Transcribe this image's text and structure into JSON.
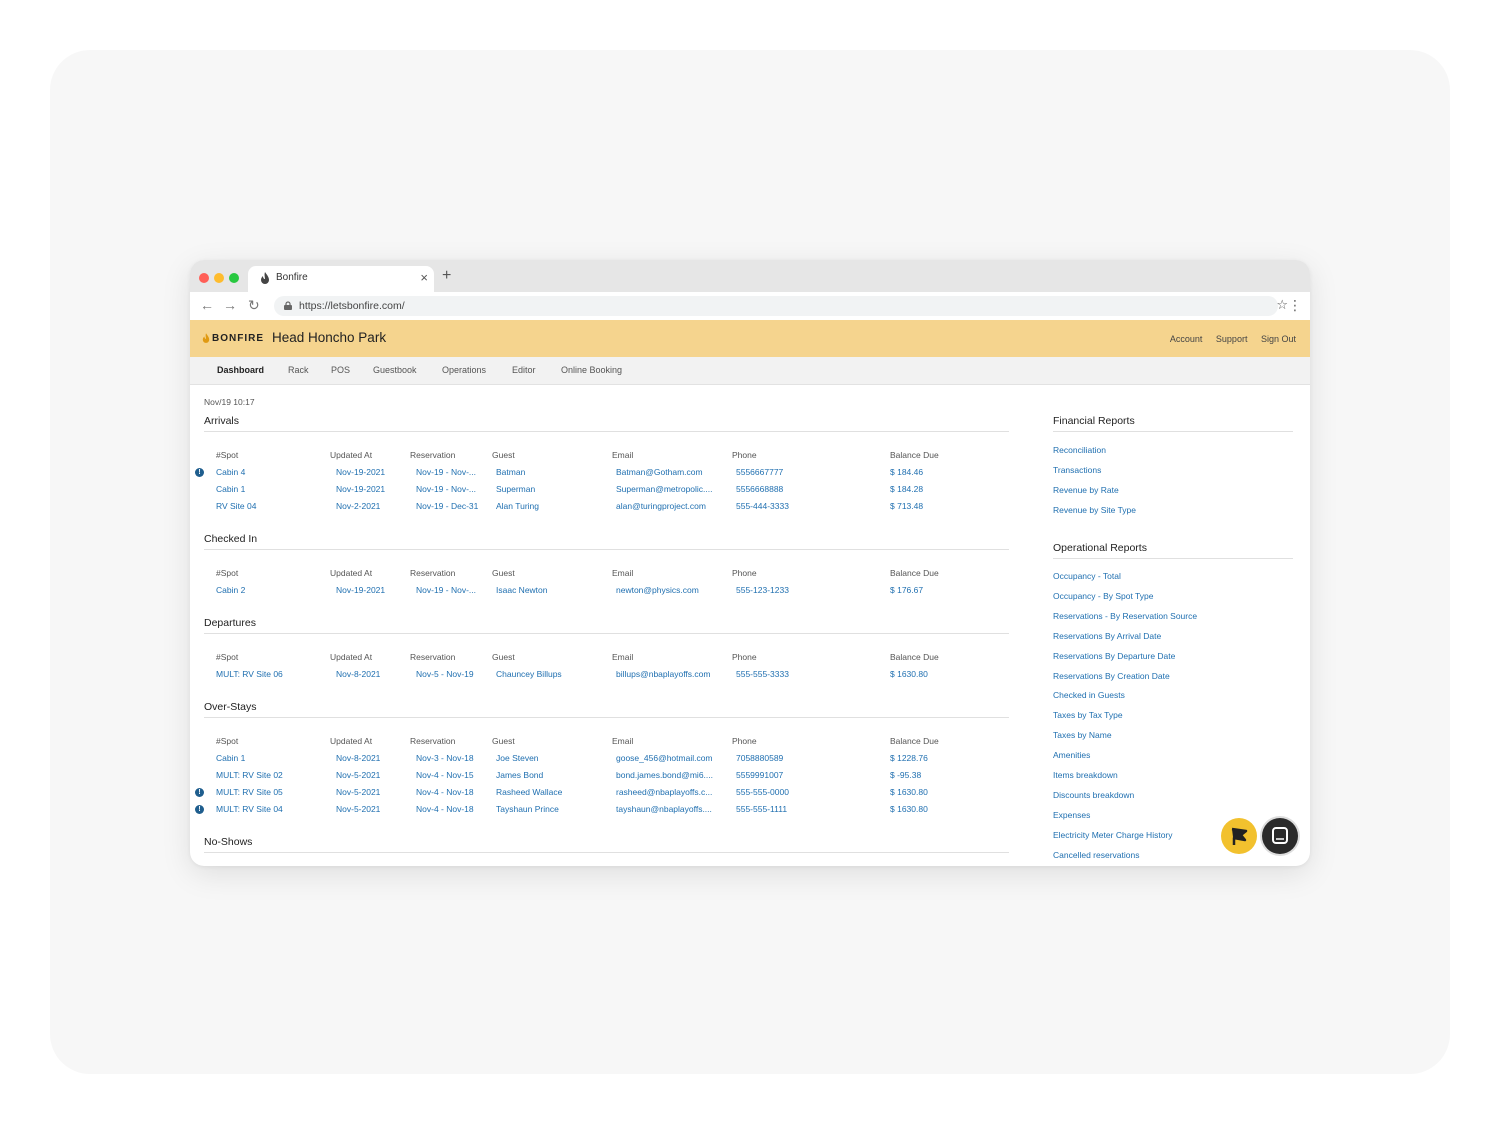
{
  "browser": {
    "tab_title": "Bonfire",
    "url": "https://letsbonfire.com/"
  },
  "app": {
    "brand": "BONFIRE",
    "park_name": "Head Honcho Park",
    "top_links": [
      "Account",
      "Support",
      "Sign Out"
    ],
    "nav_tabs": [
      "Dashboard",
      "Rack",
      "POS",
      "Guestbook",
      "Operations",
      "Editor",
      "Online Booking"
    ],
    "active_tab": "Dashboard",
    "colors": {
      "header": "#f5d48e",
      "link": "#1f6fb0",
      "fab": "#f2c12e"
    }
  },
  "dashboard": {
    "timestamp": "Nov/19 10:17",
    "columns": [
      "#Spot",
      "Updated At",
      "Reservation",
      "Guest",
      "Email",
      "Phone",
      "Balance Due"
    ],
    "sections": [
      {
        "title": "Arrivals",
        "rows": [
          {
            "alert": true,
            "cells": [
              "Cabin 4",
              "Nov-19-2021",
              "Nov-19 - Nov-...",
              "Batman",
              "Batman@Gotham.com",
              "5556667777",
              "$ 184.46"
            ]
          },
          {
            "alert": false,
            "cells": [
              "Cabin 1",
              "Nov-19-2021",
              "Nov-19 - Nov-...",
              "Superman",
              "Superman@metropolic....",
              "5556668888",
              "$ 184.28"
            ]
          },
          {
            "alert": false,
            "cells": [
              "RV Site 04",
              "Nov-2-2021",
              "Nov-19 - Dec-31",
              "Alan Turing",
              "alan@turingproject.com",
              "555-444-3333",
              "$ 713.48"
            ]
          }
        ]
      },
      {
        "title": "Checked In",
        "rows": [
          {
            "alert": false,
            "cells": [
              "Cabin 2",
              "Nov-19-2021",
              "Nov-19 - Nov-...",
              "Isaac Newton",
              "newton@physics.com",
              "555-123-1233",
              "$ 176.67"
            ]
          }
        ]
      },
      {
        "title": "Departures",
        "rows": [
          {
            "alert": false,
            "cells": [
              "MULT: RV Site 06",
              "Nov-8-2021",
              "Nov-5 - Nov-19",
              "Chauncey Billups",
              "billups@nbaplayoffs.com",
              "555-555-3333",
              "$ 1630.80"
            ]
          }
        ]
      },
      {
        "title": "Over-Stays",
        "rows": [
          {
            "alert": false,
            "cells": [
              "Cabin 1",
              "Nov-8-2021",
              "Nov-3 - Nov-18",
              "Joe Steven",
              "goose_456@hotmail.com",
              "7058880589",
              "$ 1228.76"
            ]
          },
          {
            "alert": false,
            "cells": [
              "MULT: RV Site 02",
              "Nov-5-2021",
              "Nov-4 - Nov-15",
              "James Bond",
              "bond.james.bond@mi6....",
              "5559991007",
              "$ -95.38"
            ]
          },
          {
            "alert": true,
            "cells": [
              "MULT: RV Site 05",
              "Nov-5-2021",
              "Nov-4 - Nov-18",
              "Rasheed Wallace",
              "rasheed@nbaplayoffs.c...",
              "555-555-0000",
              "$ 1630.80"
            ]
          },
          {
            "alert": true,
            "cells": [
              "MULT: RV Site 04",
              "Nov-5-2021",
              "Nov-4 - Nov-18",
              "Tayshaun Prince",
              "tayshaun@nbaplayoffs....",
              "555-555-1111",
              "$ 1630.80"
            ]
          }
        ]
      },
      {
        "title": "No-Shows",
        "rows": []
      }
    ]
  },
  "reports": {
    "financial": {
      "title": "Financial Reports",
      "links": [
        "Reconciliation",
        "Transactions",
        "Revenue by Rate",
        "Revenue by Site Type"
      ]
    },
    "operational": {
      "title": "Operational Reports",
      "links": [
        "Occupancy - Total",
        "Occupancy - By Spot Type",
        "Reservations - By Reservation Source",
        "Reservations By Arrival Date",
        "Reservations By Departure Date",
        "Reservations By Creation Date",
        "Checked in Guests",
        "Taxes by Tax Type",
        "Taxes by Name",
        "Amenities",
        "Items breakdown",
        "Discounts breakdown",
        "Expenses",
        "Electricity Meter Charge History",
        "Cancelled reservations"
      ]
    }
  }
}
